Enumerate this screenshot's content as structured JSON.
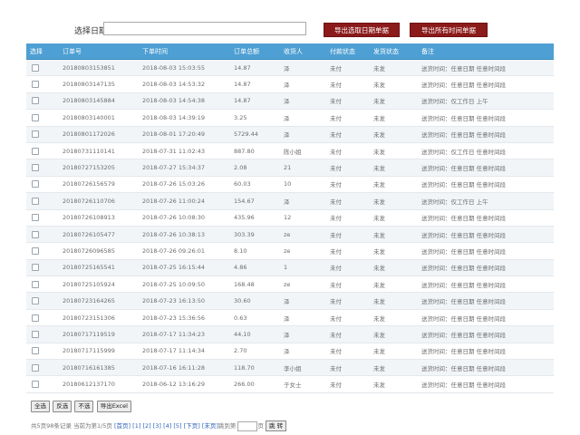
{
  "filter": {
    "date_label": "选择日期",
    "date_value": "",
    "export_selected_label": "导出选取日期单据",
    "export_all_label": "导出所有时间单据"
  },
  "table": {
    "headers": [
      "选择",
      "订单号",
      "下单时间",
      "订单总额",
      "收货人",
      "付款状态",
      "发货状态",
      "备注"
    ],
    "rows": [
      [
        "20180803153851",
        "2018-08-03 15:03:55",
        "14.87",
        "泽",
        "未付",
        "未发",
        "送货时间：任意日期 任意时间段"
      ],
      [
        "20180803147135",
        "2018-08-03 14:53:32",
        "14.87",
        "泽",
        "未付",
        "未发",
        "送货时间：任意日期 任意时间段"
      ],
      [
        "20180803145884",
        "2018-08-03 14:54:38",
        "14.87",
        "泽",
        "未付",
        "未发",
        "送货时间：仅工作日 上午"
      ],
      [
        "20180803140001",
        "2018-08-03 14:39:19",
        "3.25",
        "泽",
        "未付",
        "未发",
        "送货时间：任意日期 任意时间段"
      ],
      [
        "20180801172026",
        "2018-08-01 17:20:49",
        "5729.44",
        "泽",
        "未付",
        "未发",
        "送货时间：任意日期 任意时间段"
      ],
      [
        "20180731110141",
        "2018-07-31 11:02:43",
        "887.80",
        "陈小姐",
        "未付",
        "未发",
        "送货时间：仅工作日 任意时间段"
      ],
      [
        "20180727153205",
        "2018-07-27 15:34:37",
        "2.08",
        "21",
        "未付",
        "未发",
        "送货时间：任意日期 任意时间段"
      ],
      [
        "20180726156579",
        "2018-07-26 15:03:26",
        "60.03",
        "10",
        "未付",
        "未发",
        "送货时间：任意日期 任意时间段"
      ],
      [
        "20180726110706",
        "2018-07-26 11:00:24",
        "154.67",
        "泽",
        "未付",
        "未发",
        "送货时间：仅工作日 上午"
      ],
      [
        "20180726108913",
        "2018-07-26 10:08:30",
        "435.96",
        "12",
        "未付",
        "未发",
        "送货时间：任意日期 任意时间段"
      ],
      [
        "20180726105477",
        "2018-07-26 10:38:13",
        "303.39",
        "ze",
        "未付",
        "未发",
        "送货时间：任意日期 任意时间段"
      ],
      [
        "20180726096585",
        "2018-07-26 09:26:01",
        "8.10",
        "ze",
        "未付",
        "未发",
        "送货时间：任意日期 任意时间段"
      ],
      [
        "20180725165541",
        "2018-07-25 16:15:44",
        "4.86",
        "1",
        "未付",
        "未发",
        "送货时间：任意日期 任意时间段"
      ],
      [
        "20180725105924",
        "2018-07-25 10:09:50",
        "168.48",
        "ze",
        "未付",
        "未发",
        "送货时间：任意日期 任意时间段"
      ],
      [
        "20180723164265",
        "2018-07-23 16:13:50",
        "30.60",
        "泽",
        "未付",
        "未发",
        "送货时间：任意日期 任意时间段"
      ],
      [
        "20180723151306",
        "2018-07-23 15:36:56",
        "0.63",
        "泽",
        "未付",
        "未发",
        "送货时间：任意日期 任意时间段"
      ],
      [
        "20180717119519",
        "2018-07-17 11:34:23",
        "44.10",
        "泽",
        "未付",
        "未发",
        "送货时间：任意日期 任意时间段"
      ],
      [
        "20180717115999",
        "2018-07-17 11:14:34",
        "2.70",
        "泽",
        "未付",
        "未发",
        "送货时间：任意日期 任意时间段"
      ],
      [
        "20180716161385",
        "2018-07-16 16:11:28",
        "118.70",
        "李小姐",
        "未付",
        "未发",
        "送货时间：任意日期 任意时间段"
      ],
      [
        "20180612137170",
        "2018-06-12 13:16:29",
        "266.00",
        "于女士",
        "未付",
        "未发",
        "送货时间：任意日期 任意时间段"
      ]
    ]
  },
  "actions": {
    "select_all": "全选",
    "invert": "反选",
    "select_none": "不选",
    "export_excel": "导出Excel"
  },
  "pager": {
    "summary": "共5页98条记录 当前为第1/5页",
    "first": "[首页]",
    "pages": [
      "[1]",
      "[2]",
      "[3]",
      "[4]",
      "[5]"
    ],
    "next": "[下页]",
    "last": "[末页]",
    "jump_label": "跳到第",
    "page_suffix": "页",
    "go": "跳 转"
  }
}
